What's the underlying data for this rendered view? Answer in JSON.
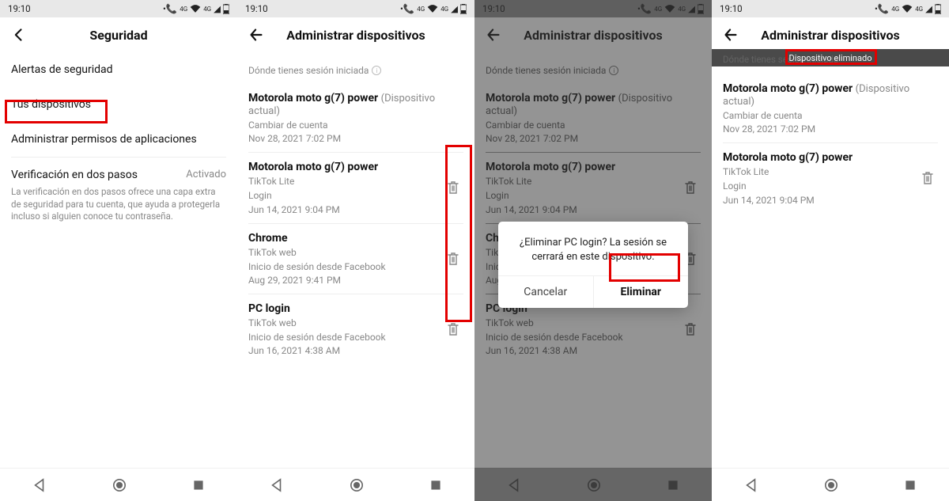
{
  "status": {
    "time": "19:10",
    "net_label": "4G"
  },
  "panel1": {
    "title": "Seguridad",
    "rows": {
      "alerts": "Alertas de seguridad",
      "devices": "Tus dispositivos",
      "perms": "Administrar permisos de aplicaciones",
      "twostep_title": "Verificación en dos pasos",
      "twostep_status": "Activado",
      "twostep_desc": "La verificación en dos pasos ofrece una capa extra de seguridad para tu cuenta, que ayuda a protegerla incluso si alguien conoce tu contraseña."
    }
  },
  "manage_title": "Administrar dispositivos",
  "session_header": "Dónde tienes sesión iniciada",
  "devices": {
    "current": {
      "name": "Motorola moto g(7) power",
      "note": "(Dispositivo actual)",
      "sub": "Cambiar de cuenta",
      "date": "Nov 28, 2021 7:02 PM"
    },
    "d2": {
      "name": "Motorola moto g(7) power",
      "sub1": "TikTok Lite",
      "sub2": "Login",
      "date": "Jun 14, 2021 9:04 PM"
    },
    "d3": {
      "name": "Chrome",
      "sub1": "TikTok web",
      "sub2": "Inicio de sesión desde Facebook",
      "date": "Aug 29, 2021 9:41 PM"
    },
    "d4": {
      "name": "PC login",
      "sub1": "TikTok web",
      "sub2": "Inicio de sesión desde Facebook",
      "date": "Jun 16, 2021 4:38 AM"
    }
  },
  "dialog": {
    "text": "¿Eliminar PC login? La sesión se cerrará en este dispositivo.",
    "cancel": "Cancelar",
    "delete": "Eliminar"
  },
  "toast": "Dispositivo eliminado"
}
